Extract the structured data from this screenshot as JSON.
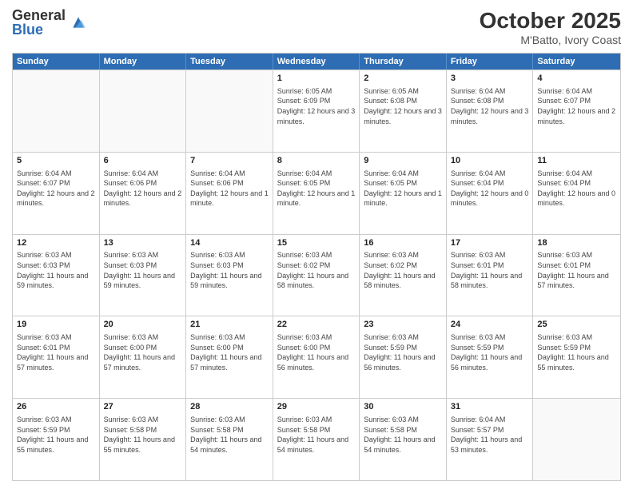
{
  "header": {
    "logo_general": "General",
    "logo_blue": "Blue",
    "month_title": "October 2025",
    "location": "M'Batto, Ivory Coast"
  },
  "days_of_week": [
    "Sunday",
    "Monday",
    "Tuesday",
    "Wednesday",
    "Thursday",
    "Friday",
    "Saturday"
  ],
  "weeks": [
    [
      {
        "date": "",
        "info": ""
      },
      {
        "date": "",
        "info": ""
      },
      {
        "date": "",
        "info": ""
      },
      {
        "date": "1",
        "info": "Sunrise: 6:05 AM\nSunset: 6:09 PM\nDaylight: 12 hours and 3 minutes."
      },
      {
        "date": "2",
        "info": "Sunrise: 6:05 AM\nSunset: 6:08 PM\nDaylight: 12 hours and 3 minutes."
      },
      {
        "date": "3",
        "info": "Sunrise: 6:04 AM\nSunset: 6:08 PM\nDaylight: 12 hours and 3 minutes."
      },
      {
        "date": "4",
        "info": "Sunrise: 6:04 AM\nSunset: 6:07 PM\nDaylight: 12 hours and 2 minutes."
      }
    ],
    [
      {
        "date": "5",
        "info": "Sunrise: 6:04 AM\nSunset: 6:07 PM\nDaylight: 12 hours and 2 minutes."
      },
      {
        "date": "6",
        "info": "Sunrise: 6:04 AM\nSunset: 6:06 PM\nDaylight: 12 hours and 2 minutes."
      },
      {
        "date": "7",
        "info": "Sunrise: 6:04 AM\nSunset: 6:06 PM\nDaylight: 12 hours and 1 minute."
      },
      {
        "date": "8",
        "info": "Sunrise: 6:04 AM\nSunset: 6:05 PM\nDaylight: 12 hours and 1 minute."
      },
      {
        "date": "9",
        "info": "Sunrise: 6:04 AM\nSunset: 6:05 PM\nDaylight: 12 hours and 1 minute."
      },
      {
        "date": "10",
        "info": "Sunrise: 6:04 AM\nSunset: 6:04 PM\nDaylight: 12 hours and 0 minutes."
      },
      {
        "date": "11",
        "info": "Sunrise: 6:04 AM\nSunset: 6:04 PM\nDaylight: 12 hours and 0 minutes."
      }
    ],
    [
      {
        "date": "12",
        "info": "Sunrise: 6:03 AM\nSunset: 6:03 PM\nDaylight: 11 hours and 59 minutes."
      },
      {
        "date": "13",
        "info": "Sunrise: 6:03 AM\nSunset: 6:03 PM\nDaylight: 11 hours and 59 minutes."
      },
      {
        "date": "14",
        "info": "Sunrise: 6:03 AM\nSunset: 6:03 PM\nDaylight: 11 hours and 59 minutes."
      },
      {
        "date": "15",
        "info": "Sunrise: 6:03 AM\nSunset: 6:02 PM\nDaylight: 11 hours and 58 minutes."
      },
      {
        "date": "16",
        "info": "Sunrise: 6:03 AM\nSunset: 6:02 PM\nDaylight: 11 hours and 58 minutes."
      },
      {
        "date": "17",
        "info": "Sunrise: 6:03 AM\nSunset: 6:01 PM\nDaylight: 11 hours and 58 minutes."
      },
      {
        "date": "18",
        "info": "Sunrise: 6:03 AM\nSunset: 6:01 PM\nDaylight: 11 hours and 57 minutes."
      }
    ],
    [
      {
        "date": "19",
        "info": "Sunrise: 6:03 AM\nSunset: 6:01 PM\nDaylight: 11 hours and 57 minutes."
      },
      {
        "date": "20",
        "info": "Sunrise: 6:03 AM\nSunset: 6:00 PM\nDaylight: 11 hours and 57 minutes."
      },
      {
        "date": "21",
        "info": "Sunrise: 6:03 AM\nSunset: 6:00 PM\nDaylight: 11 hours and 57 minutes."
      },
      {
        "date": "22",
        "info": "Sunrise: 6:03 AM\nSunset: 6:00 PM\nDaylight: 11 hours and 56 minutes."
      },
      {
        "date": "23",
        "info": "Sunrise: 6:03 AM\nSunset: 5:59 PM\nDaylight: 11 hours and 56 minutes."
      },
      {
        "date": "24",
        "info": "Sunrise: 6:03 AM\nSunset: 5:59 PM\nDaylight: 11 hours and 56 minutes."
      },
      {
        "date": "25",
        "info": "Sunrise: 6:03 AM\nSunset: 5:59 PM\nDaylight: 11 hours and 55 minutes."
      }
    ],
    [
      {
        "date": "26",
        "info": "Sunrise: 6:03 AM\nSunset: 5:59 PM\nDaylight: 11 hours and 55 minutes."
      },
      {
        "date": "27",
        "info": "Sunrise: 6:03 AM\nSunset: 5:58 PM\nDaylight: 11 hours and 55 minutes."
      },
      {
        "date": "28",
        "info": "Sunrise: 6:03 AM\nSunset: 5:58 PM\nDaylight: 11 hours and 54 minutes."
      },
      {
        "date": "29",
        "info": "Sunrise: 6:03 AM\nSunset: 5:58 PM\nDaylight: 11 hours and 54 minutes."
      },
      {
        "date": "30",
        "info": "Sunrise: 6:03 AM\nSunset: 5:58 PM\nDaylight: 11 hours and 54 minutes."
      },
      {
        "date": "31",
        "info": "Sunrise: 6:04 AM\nSunset: 5:57 PM\nDaylight: 11 hours and 53 minutes."
      },
      {
        "date": "",
        "info": ""
      }
    ]
  ]
}
